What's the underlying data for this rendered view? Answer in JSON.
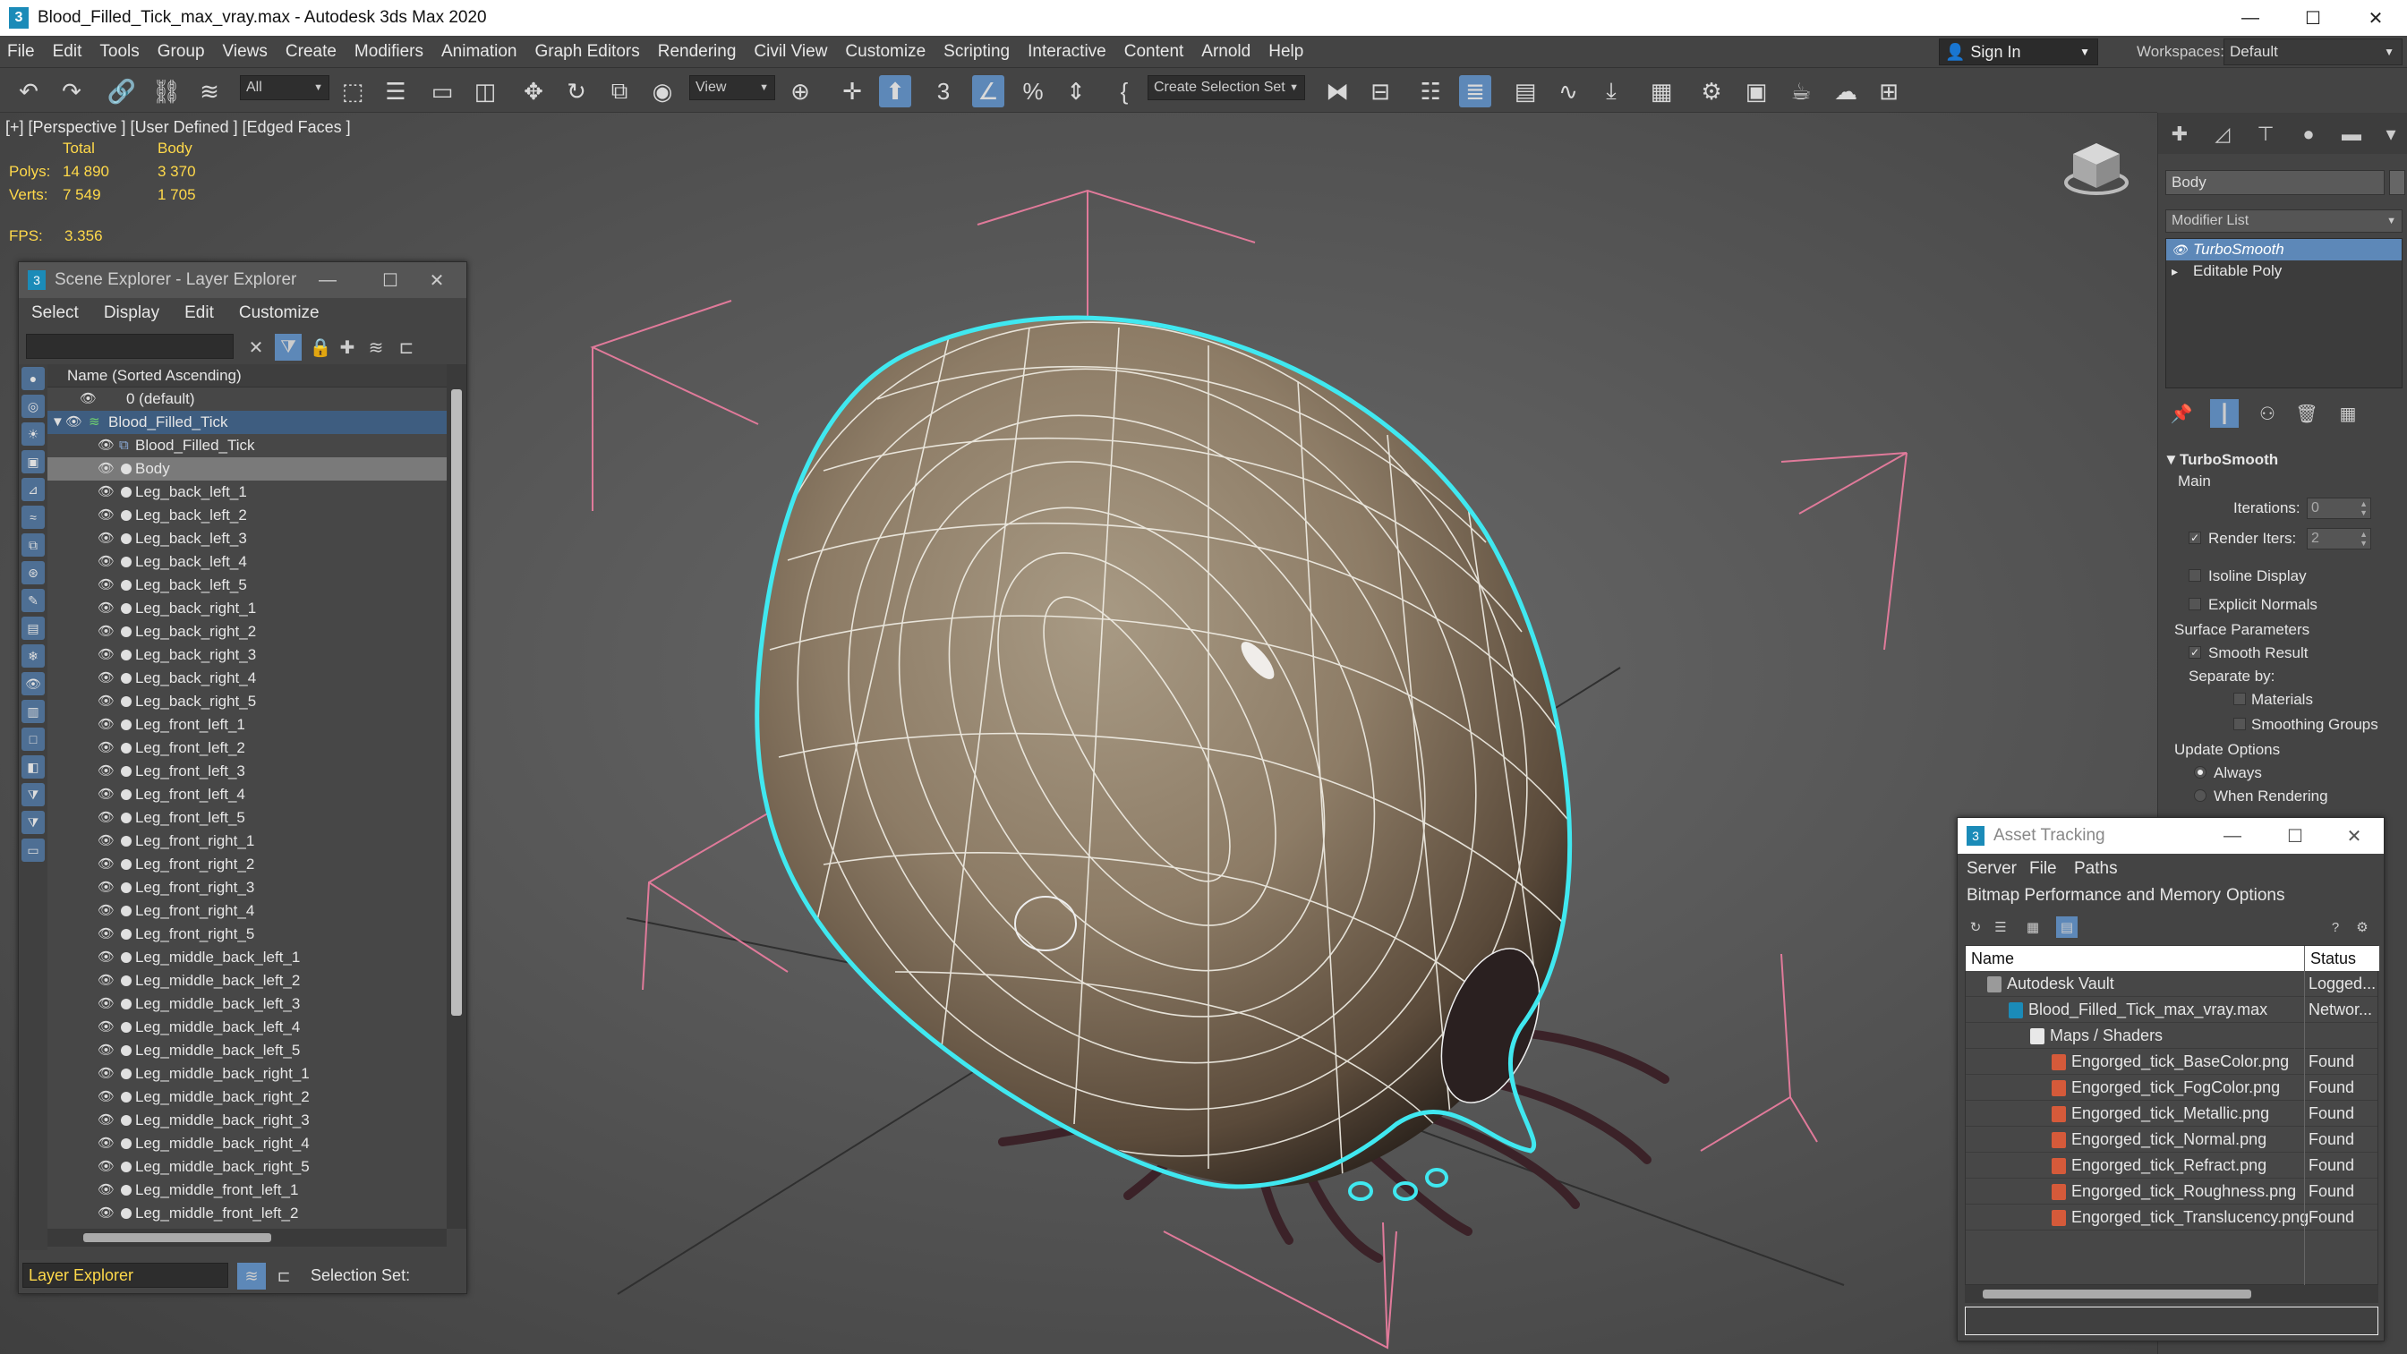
{
  "window": {
    "title": "Blood_Filled_Tick_max_vray.max - Autodesk 3ds Max 2020",
    "app_icon": "3",
    "minimize": "—",
    "maximize": "☐",
    "close": "✕"
  },
  "menu": [
    "File",
    "Edit",
    "Tools",
    "Group",
    "Views",
    "Create",
    "Modifiers",
    "Animation",
    "Graph Editors",
    "Rendering",
    "Civil View",
    "Customize",
    "Scripting",
    "Interactive",
    "Content",
    "Arnold",
    "Help"
  ],
  "account": {
    "sign_in": "Sign In",
    "workspaces_label": "Workspaces:",
    "workspace": "Default"
  },
  "toolbar": {
    "filter": "All",
    "ref_coord": "View",
    "selection_set": "Create Selection Set"
  },
  "viewport": {
    "label": "[+] [Perspective ] [User Defined ] [Edged Faces ]",
    "stats": {
      "col_total": "Total",
      "col_body": "Body",
      "polys_label": "Polys:",
      "polys_total": "14 890",
      "polys_body": "3 370",
      "verts_label": "Verts:",
      "verts_total": "7 549",
      "verts_body": "1 705",
      "fps_label": "FPS:",
      "fps": "3.356"
    }
  },
  "scene_explorer": {
    "title": "Scene Explorer - Layer Explorer",
    "menu": [
      "Select",
      "Display",
      "Edit",
      "Customize"
    ],
    "header": "Name (Sorted Ascending)",
    "layer_default": "0 (default)",
    "group": "Blood_Filled_Tick",
    "items": [
      "Blood_Filled_Tick",
      "Body",
      "Leg_back_left_1",
      "Leg_back_left_2",
      "Leg_back_left_3",
      "Leg_back_left_4",
      "Leg_back_left_5",
      "Leg_back_right_1",
      "Leg_back_right_2",
      "Leg_back_right_3",
      "Leg_back_right_4",
      "Leg_back_right_5",
      "Leg_front_left_1",
      "Leg_front_left_2",
      "Leg_front_left_3",
      "Leg_front_left_4",
      "Leg_front_left_5",
      "Leg_front_right_1",
      "Leg_front_right_2",
      "Leg_front_right_3",
      "Leg_front_right_4",
      "Leg_front_right_5",
      "Leg_middle_back_left_1",
      "Leg_middle_back_left_2",
      "Leg_middle_back_left_3",
      "Leg_middle_back_left_4",
      "Leg_middle_back_left_5",
      "Leg_middle_back_right_1",
      "Leg_middle_back_right_2",
      "Leg_middle_back_right_3",
      "Leg_middle_back_right_4",
      "Leg_middle_back_right_5",
      "Leg_middle_front_left_1",
      "Leg_middle_front_left_2"
    ],
    "footer_explorer": "Layer Explorer",
    "selection_set_label": "Selection Set:"
  },
  "command_panel": {
    "object_name": "Body",
    "modifier_list": "Modifier List",
    "stack": [
      "TurboSmooth",
      "Editable Poly"
    ],
    "rollout": {
      "title": "TurboSmooth",
      "main": "Main",
      "iterations_label": "Iterations:",
      "iterations": "0",
      "render_iters_label": "Render Iters:",
      "render_iters": "2",
      "isoline": "Isoline Display",
      "explicit_normals": "Explicit Normals",
      "surface_params": "Surface Parameters",
      "smooth_result": "Smooth Result",
      "separate_by": "Separate by:",
      "materials": "Materials",
      "smoothing_groups": "Smoothing Groups",
      "update_options": "Update Options",
      "always": "Always",
      "when_rendering": "When Rendering"
    }
  },
  "asset_tracking": {
    "title": "Asset Tracking",
    "menu_row1": [
      "Server",
      "File",
      "Paths"
    ],
    "menu_row2": [
      "Bitmap Performance and Memory",
      "Options"
    ],
    "col_name": "Name",
    "col_status": "Status",
    "rows": [
      {
        "name": "Autodesk Vault",
        "status": "Logged...",
        "indent": 0
      },
      {
        "name": "Blood_Filled_Tick_max_vray.max",
        "status": "Networ...",
        "indent": 1
      },
      {
        "name": "Maps / Shaders",
        "status": "",
        "indent": 2
      },
      {
        "name": "Engorged_tick_BaseColor.png",
        "status": "Found",
        "indent": 3
      },
      {
        "name": "Engorged_tick_FogColor.png",
        "status": "Found",
        "indent": 3
      },
      {
        "name": "Engorged_tick_Metallic.png",
        "status": "Found",
        "indent": 3
      },
      {
        "name": "Engorged_tick_Normal.png",
        "status": "Found",
        "indent": 3
      },
      {
        "name": "Engorged_tick_Refract.png",
        "status": "Found",
        "indent": 3
      },
      {
        "name": "Engorged_tick_Roughness.png",
        "status": "Found",
        "indent": 3
      },
      {
        "name": "Engorged_tick_Translucency.png",
        "status": "Found",
        "indent": 3
      }
    ]
  },
  "colors": {
    "accent": "#5d88b8",
    "stats_yellow": "#ffd94a",
    "selection_cyan": "#40e8f0",
    "gizmo_pink": "#e07a9a"
  }
}
